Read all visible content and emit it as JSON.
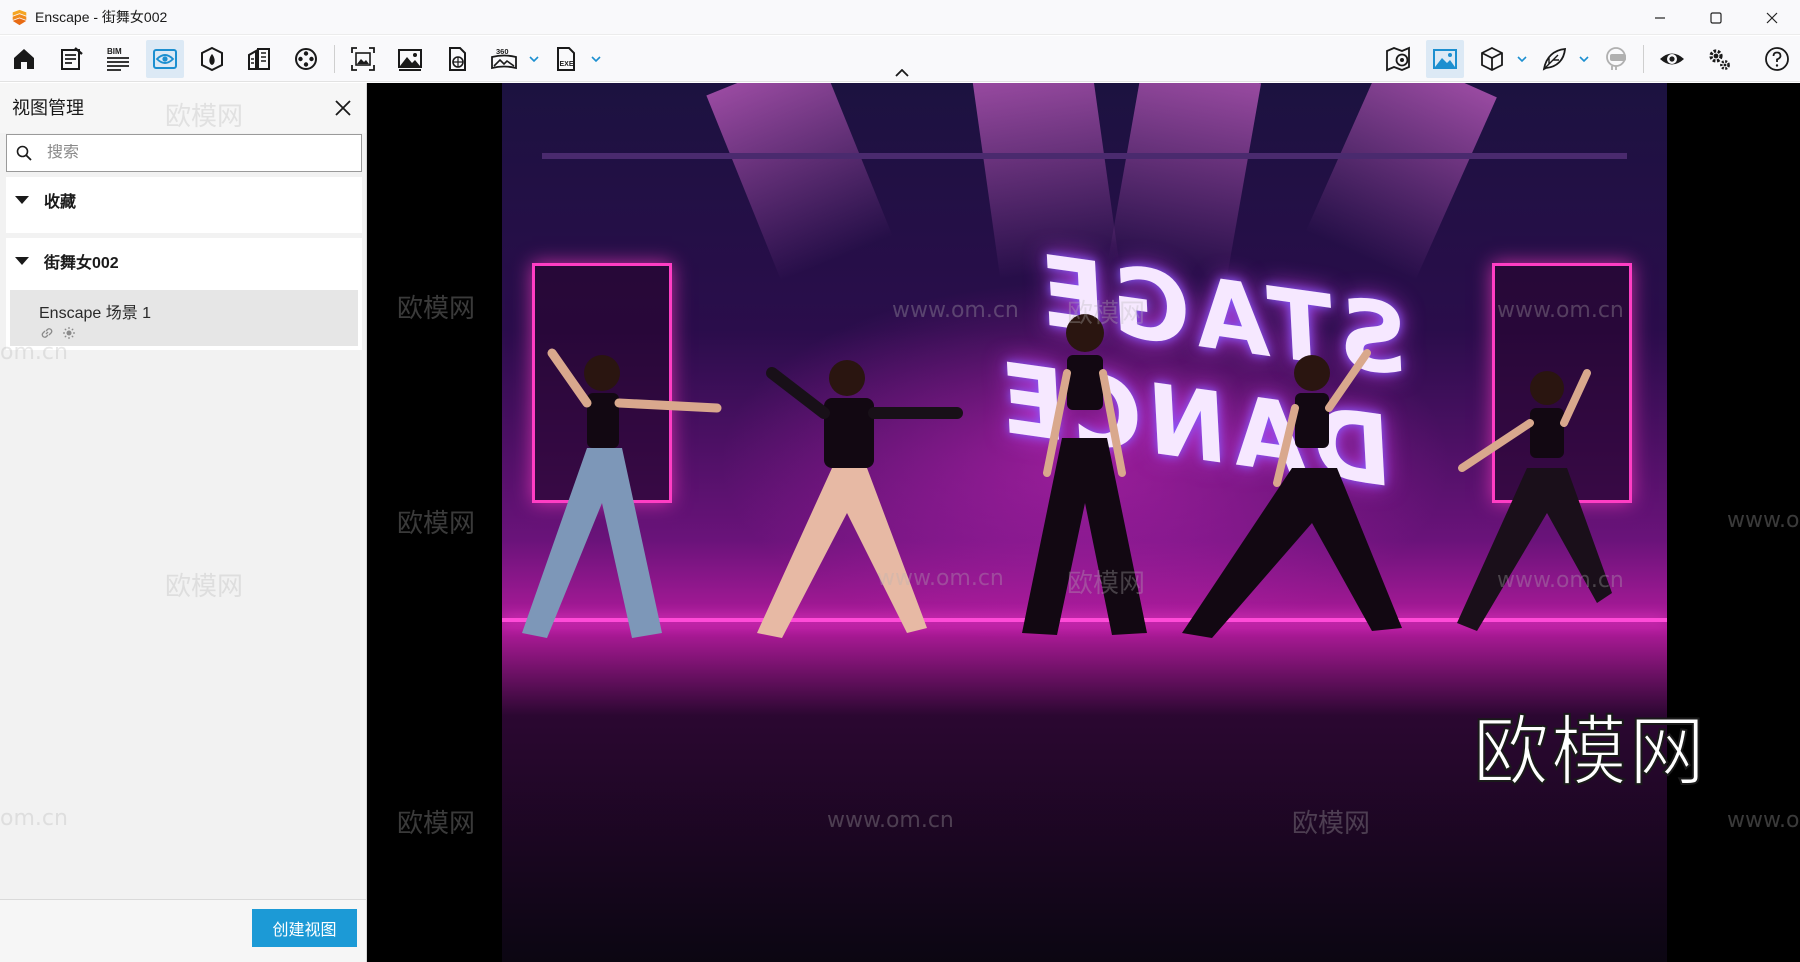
{
  "window": {
    "title": "Enscape - 街舞女002",
    "controls": [
      "minimize-icon",
      "maximize-icon",
      "close-icon"
    ]
  },
  "toolbar": {
    "left_tools": [
      {
        "icon": "home-icon"
      },
      {
        "icon": "project-sheet-icon"
      },
      {
        "icon": "bim-icon",
        "label": "BIM"
      },
      {
        "icon": "view-management-icon",
        "active": true
      },
      {
        "icon": "material-palette-icon"
      },
      {
        "icon": "asset-library-icon"
      },
      {
        "icon": "video-editor-icon"
      },
      {
        "icon": "screenshot-icon"
      },
      {
        "icon": "image-icon"
      },
      {
        "icon": "web-export-icon"
      },
      {
        "icon": "panorama-icon",
        "label": "360",
        "dropdown": true
      },
      {
        "icon": "exe-export-icon",
        "label": "EXE",
        "dropdown": true
      }
    ],
    "right_tools": [
      {
        "icon": "map-pin-icon"
      },
      {
        "icon": "landscape-icon"
      },
      {
        "icon": "cube-icon",
        "dropdown": true
      },
      {
        "icon": "leaf-icon",
        "dropdown": true
      },
      {
        "icon": "vr-headset-icon"
      },
      {
        "icon": "eye-icon"
      },
      {
        "icon": "settings-icon"
      },
      {
        "icon": "help-icon"
      }
    ]
  },
  "panel": {
    "title": "视图管理",
    "search_placeholder": "搜索",
    "sections": [
      {
        "label": "收藏",
        "expanded": true
      },
      {
        "label": "街舞女002",
        "expanded": true,
        "items": [
          {
            "name": "Enscape 场景 1"
          }
        ]
      }
    ],
    "create_button": "创建视图"
  },
  "viewport": {
    "backdrop_text": "STAGE DANCE",
    "watermark_brand": "欧模网",
    "watermark_url": "www.om.cn",
    "watermark_short": "om.cn"
  },
  "colors": {
    "accent": "#1c9ad6",
    "active_tool_bg": "#dce9f5",
    "neon_pink": "#ff3dc4"
  }
}
